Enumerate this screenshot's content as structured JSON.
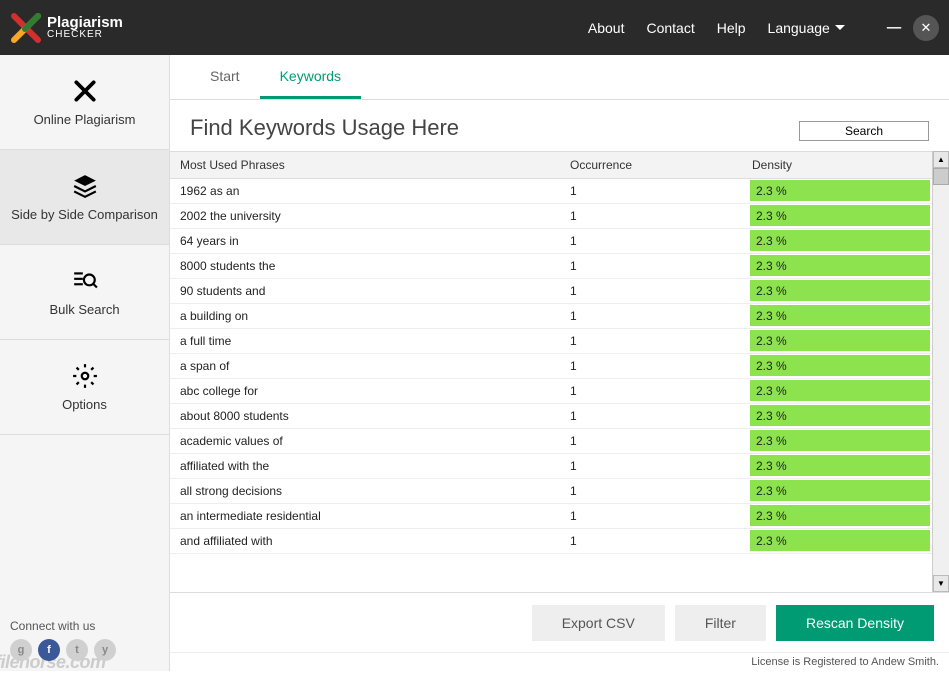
{
  "logo": {
    "main": "Plagiarism",
    "sub": "CHECKER"
  },
  "top_nav": {
    "about": "About",
    "contact": "Contact",
    "help": "Help",
    "language": "Language"
  },
  "sidebar": {
    "items": [
      {
        "label": "Online Plagiarism"
      },
      {
        "label": "Side by Side Comparison"
      },
      {
        "label": "Bulk Search"
      },
      {
        "label": "Options"
      }
    ],
    "connect": "Connect with us"
  },
  "tabs": {
    "start": "Start",
    "keywords": "Keywords"
  },
  "heading": "Find Keywords Usage Here",
  "search_placeholder": "Search",
  "table": {
    "headers": {
      "phrase": "Most Used Phrases",
      "occurrence": "Occurrence",
      "density": "Density"
    },
    "rows": [
      {
        "phrase": "1962 as an",
        "occurrence": "1",
        "density": "2.3 %"
      },
      {
        "phrase": "2002 the university",
        "occurrence": "1",
        "density": "2.3 %"
      },
      {
        "phrase": "64 years in",
        "occurrence": "1",
        "density": "2.3 %"
      },
      {
        "phrase": "8000 students the",
        "occurrence": "1",
        "density": "2.3 %"
      },
      {
        "phrase": "90 students and",
        "occurrence": "1",
        "density": "2.3 %"
      },
      {
        "phrase": "a building on",
        "occurrence": "1",
        "density": "2.3 %"
      },
      {
        "phrase": "a full time",
        "occurrence": "1",
        "density": "2.3 %"
      },
      {
        "phrase": "a span of",
        "occurrence": "1",
        "density": "2.3 %"
      },
      {
        "phrase": "abc college for",
        "occurrence": "1",
        "density": "2.3 %"
      },
      {
        "phrase": "about 8000 students",
        "occurrence": "1",
        "density": "2.3 %"
      },
      {
        "phrase": "academic values of",
        "occurrence": "1",
        "density": "2.3 %"
      },
      {
        "phrase": "affiliated with the",
        "occurrence": "1",
        "density": "2.3 %"
      },
      {
        "phrase": "all strong decisions",
        "occurrence": "1",
        "density": "2.3 %"
      },
      {
        "phrase": "an intermediate residential",
        "occurrence": "1",
        "density": "2.3 %"
      },
      {
        "phrase": "and affiliated with",
        "occurrence": "1",
        "density": "2.3 %"
      }
    ]
  },
  "buttons": {
    "export": "Export CSV",
    "filter": "Filter",
    "rescan": "Rescan Density"
  },
  "status": "License is Registered to Andew Smith."
}
